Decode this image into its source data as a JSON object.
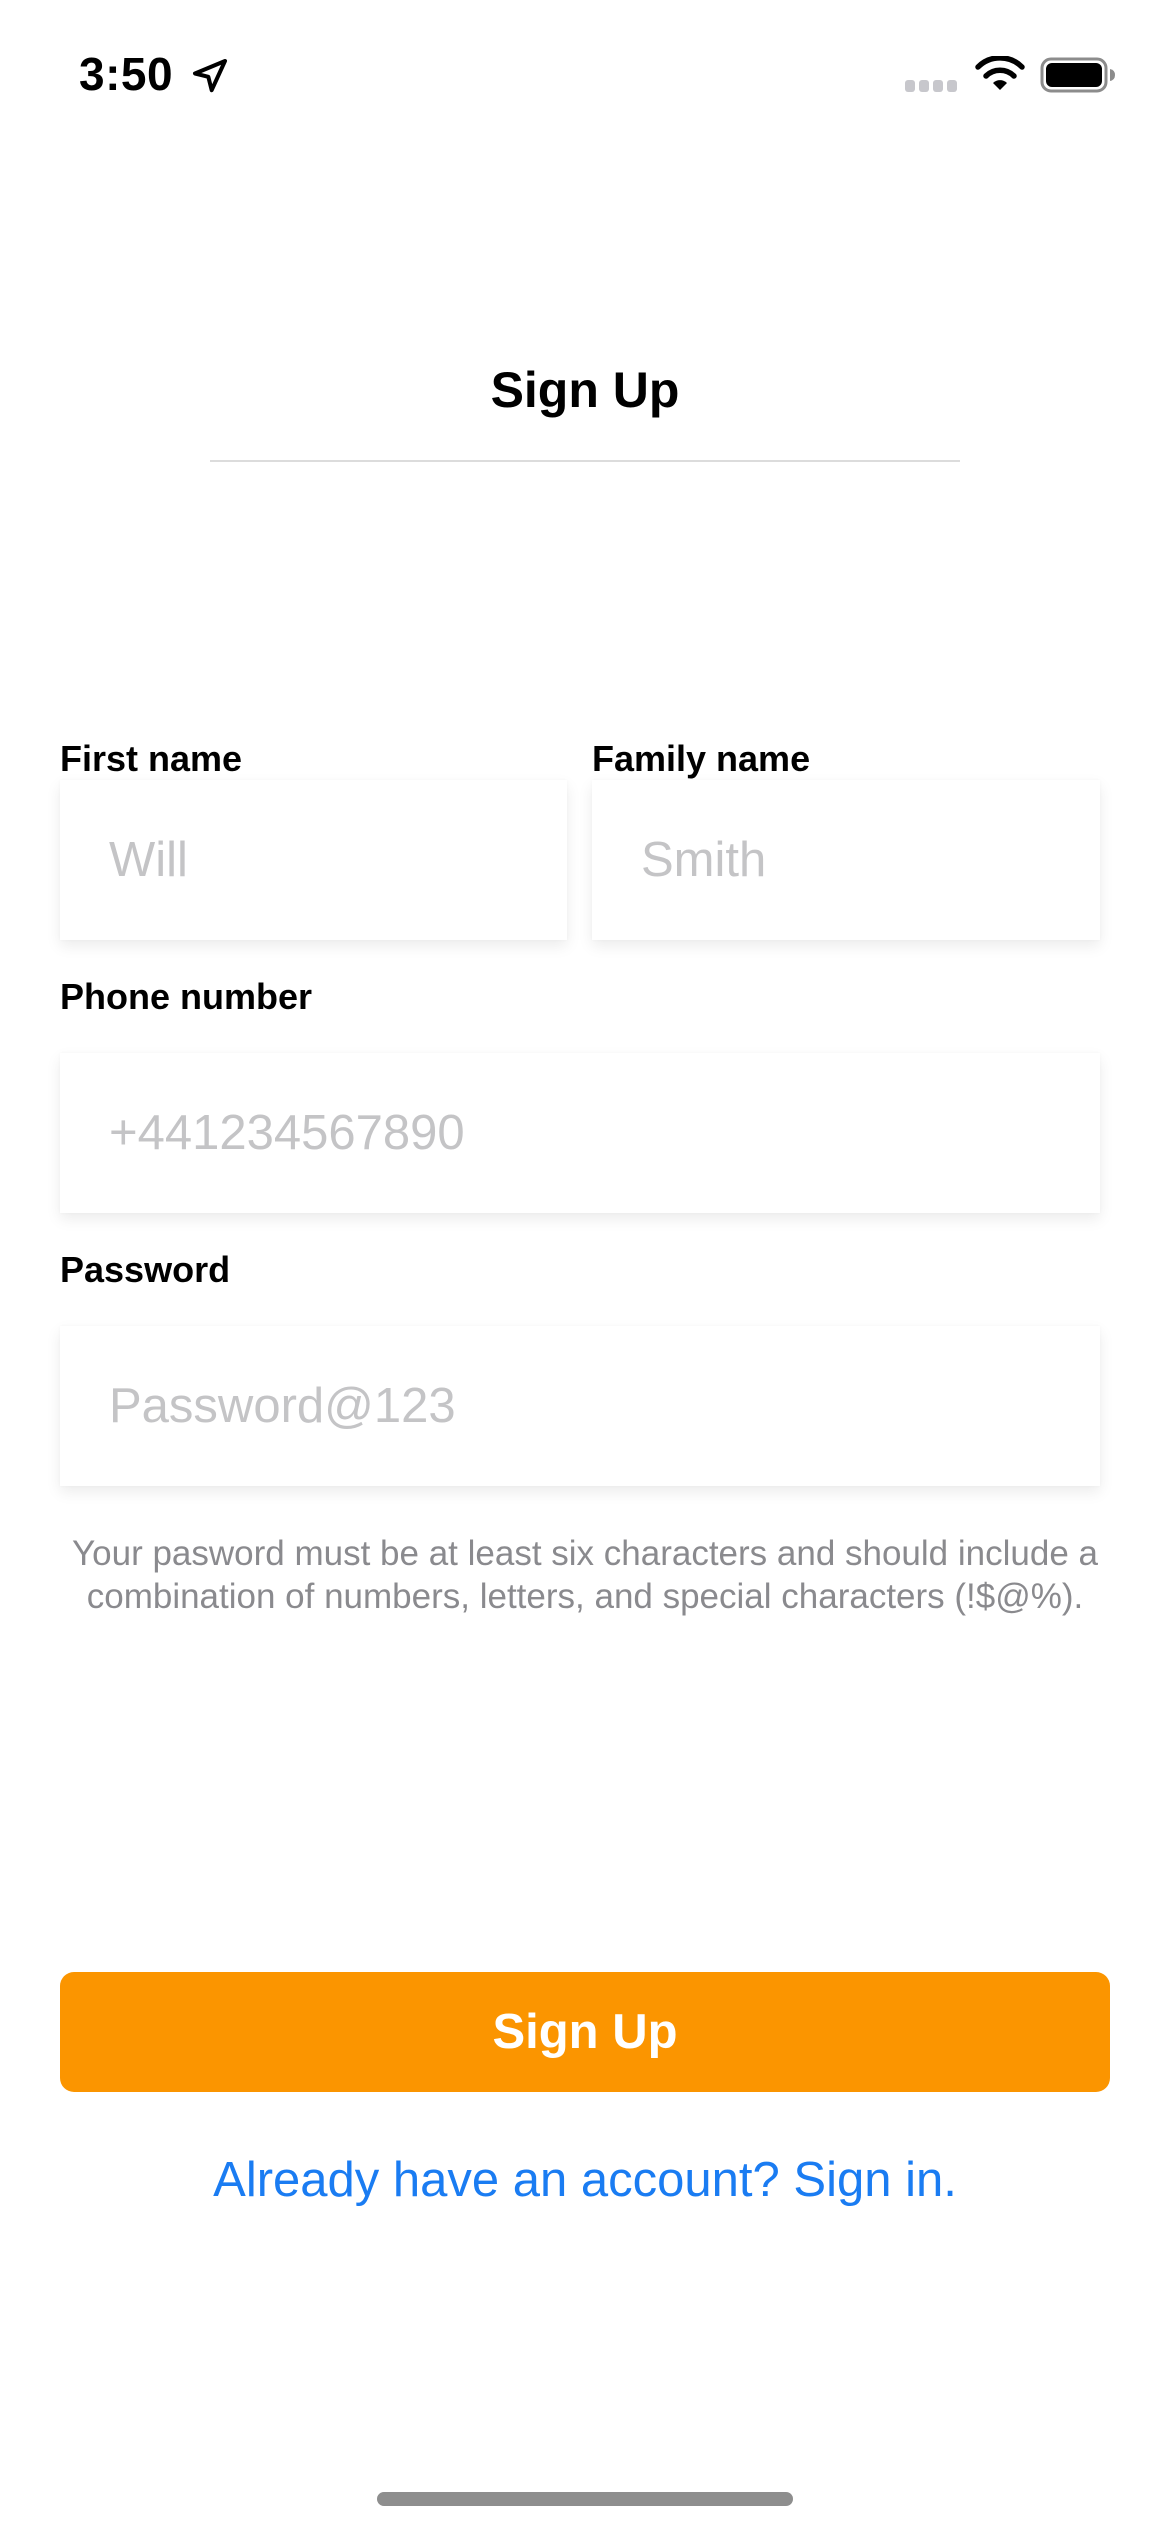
{
  "status_bar": {
    "time": "3:50",
    "icons": [
      "location-arrow-icon",
      "cellular-signal-icon",
      "wifi-icon",
      "battery-icon"
    ]
  },
  "title": "Sign Up",
  "form": {
    "first_name": {
      "label": "First name",
      "placeholder": "Will",
      "value": ""
    },
    "family_name": {
      "label": "Family name",
      "placeholder": "Smith",
      "value": ""
    },
    "phone": {
      "label": "Phone number",
      "placeholder": "+441234567890",
      "value": ""
    },
    "password": {
      "label": "Password",
      "placeholder": "Password@123",
      "value": ""
    },
    "password_hint": "Your pasword must be at least six characters and should include a combination of numbers, letters, and special characters (!$@%)."
  },
  "signup_button_label": "Sign Up",
  "signin_link": "Already have an account? Sign in.",
  "colors": {
    "accent": "#fb9500",
    "link": "#1a7cf2",
    "placeholder": "#c4c4c6",
    "hint": "#8a8a8e"
  }
}
